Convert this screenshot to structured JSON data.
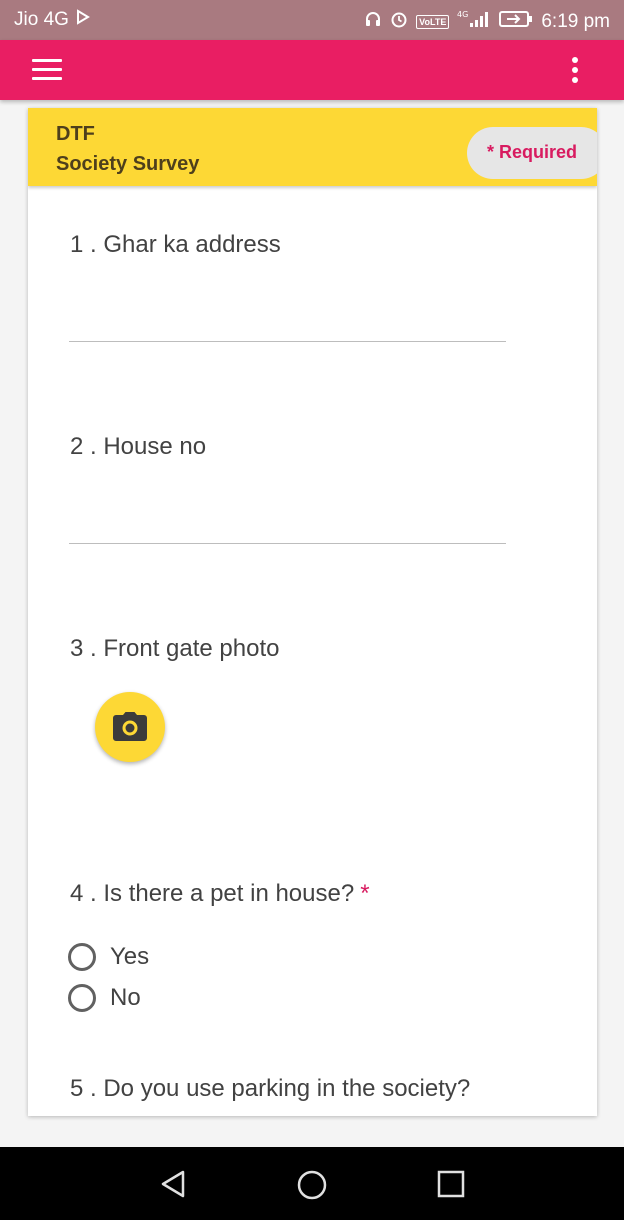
{
  "status_bar": {
    "carrier": "Jio 4G",
    "network": "4G",
    "volte": "VoLTE",
    "time": "6:19 pm"
  },
  "app_bar": {
    "menu_icon": "hamburger-menu-icon",
    "overflow_icon": "more-vertical-icon",
    "color": "#e91e63"
  },
  "form": {
    "org": "DTF",
    "title": "Society Survey",
    "required_label": "* Required",
    "header_color": "#fdd835",
    "accent_color": "#d81b60",
    "questions": [
      {
        "label": "1 . Ghar ka address",
        "type": "text",
        "value": ""
      },
      {
        "label": "2 . House no",
        "type": "text",
        "value": ""
      },
      {
        "label": "3 . Front gate photo",
        "type": "photo",
        "icon": "camera-icon"
      },
      {
        "label": "4 . Is there a pet in house?",
        "type": "radio",
        "required_mark": "*",
        "options": [
          "Yes",
          "No"
        ]
      },
      {
        "label": "5 . Do you use parking in the society?",
        "type": "radio"
      }
    ]
  },
  "nav_bar": {
    "back_icon": "back-triangle-icon",
    "home_icon": "home-circle-icon",
    "recents_icon": "recents-square-icon"
  }
}
